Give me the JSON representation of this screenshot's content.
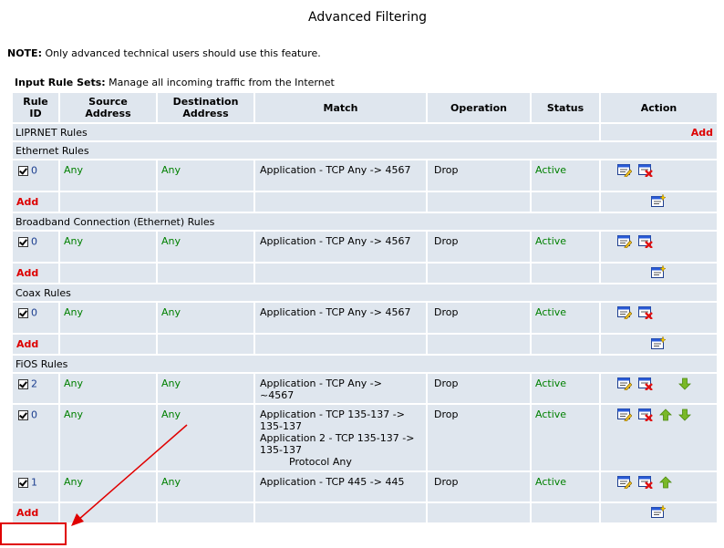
{
  "page": {
    "title": "Advanced Filtering",
    "note_label": "NOTE:",
    "note_text": "Only advanced technical users should use this feature.",
    "input_label": "Input Rule Sets:",
    "input_text": "Manage all incoming traffic from the Internet"
  },
  "table": {
    "headers": {
      "rule_id_1": "Rule",
      "rule_id_2": "ID",
      "source_1": "Source",
      "source_2": "Address",
      "destination_1": "Destination",
      "destination_2": "Address",
      "match": "Match",
      "operation": "Operation",
      "status": "Status",
      "action": "Action"
    },
    "add_label": "Add",
    "sections": {
      "liprnet": {
        "title": "LIPRNET Rules",
        "add": "Add"
      },
      "ethernet": {
        "title": "Ethernet Rules",
        "rows": [
          {
            "id": "0",
            "source": "Any",
            "destination": "Any",
            "match": [
              "Application - TCP Any -> 4567"
            ],
            "operation": "Drop",
            "status": "Active"
          }
        ],
        "add": "Add"
      },
      "broadband": {
        "title": "Broadband Connection (Ethernet) Rules",
        "rows": [
          {
            "id": "0",
            "source": "Any",
            "destination": "Any",
            "match": [
              "Application - TCP Any -> 4567"
            ],
            "operation": "Drop",
            "status": "Active"
          }
        ],
        "add": "Add"
      },
      "coax": {
        "title": "Coax Rules",
        "rows": [
          {
            "id": "0",
            "source": "Any",
            "destination": "Any",
            "match": [
              "Application - TCP Any -> 4567"
            ],
            "operation": "Drop",
            "status": "Active"
          }
        ],
        "add": "Add"
      },
      "fios": {
        "title": "FiOS Rules",
        "rows": [
          {
            "id": "2",
            "source": "Any",
            "destination": "Any",
            "match": [
              "Application - TCP Any ->",
              "~4567"
            ],
            "operation": "Drop",
            "status": "Active"
          },
          {
            "id": "0",
            "source": "Any",
            "destination": "Any",
            "match": [
              "Application - TCP 135-137 ->",
              "135-137",
              "Application 2 - TCP 135-137 ->",
              "135-137",
              "Protocol Any"
            ],
            "operation": "Drop",
            "status": "Active"
          },
          {
            "id": "1",
            "source": "Any",
            "destination": "Any",
            "match": [
              "Application - TCP 445 -> 445"
            ],
            "operation": "Drop",
            "status": "Active"
          }
        ],
        "add": "Add"
      }
    }
  },
  "icons": {
    "edit": "edit-rule-icon",
    "delete": "delete-rule-icon",
    "move_up": "move-up-arrow-icon",
    "move_down": "move-down-arrow-icon",
    "new": "new-rule-icon"
  },
  "colors": {
    "cell_bg": "#dfe6ee",
    "value_green": "#008000",
    "add_red": "#dd0000",
    "arrow_green": "#7ab828",
    "annotation_red": "#e00000"
  }
}
